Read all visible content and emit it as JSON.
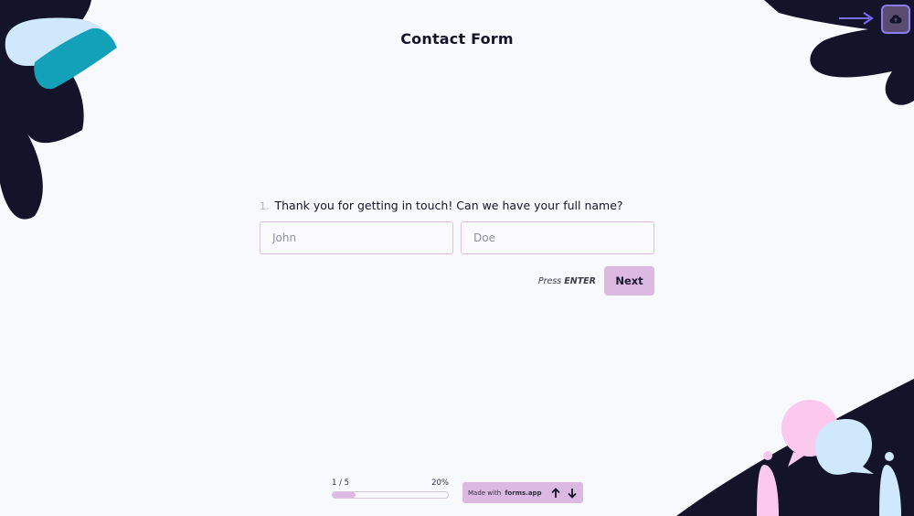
{
  "header": {
    "title": "Contact Form"
  },
  "save": {
    "icon": "cloud-save-icon",
    "hint_icon": "arrow-right-icon"
  },
  "question": {
    "number": "1.",
    "text": "Thank you for getting in touch! Can we have your full name?",
    "first_name_placeholder": "John",
    "last_name_placeholder": "Doe",
    "press_prefix": "Press",
    "press_key": "ENTER",
    "next_label": "Next"
  },
  "progress": {
    "label": "1 / 5",
    "percent_label": "20%",
    "value": 0.2
  },
  "footer": {
    "made_with": "Made with",
    "brand": "forms.app",
    "up_icon": "arrow-up-icon",
    "down_icon": "arrow-down-icon"
  },
  "colors": {
    "accent": "#dcb9e2",
    "dark": "#14142b",
    "background": "#f8f9fc",
    "highlight": "#8b7cf6"
  }
}
